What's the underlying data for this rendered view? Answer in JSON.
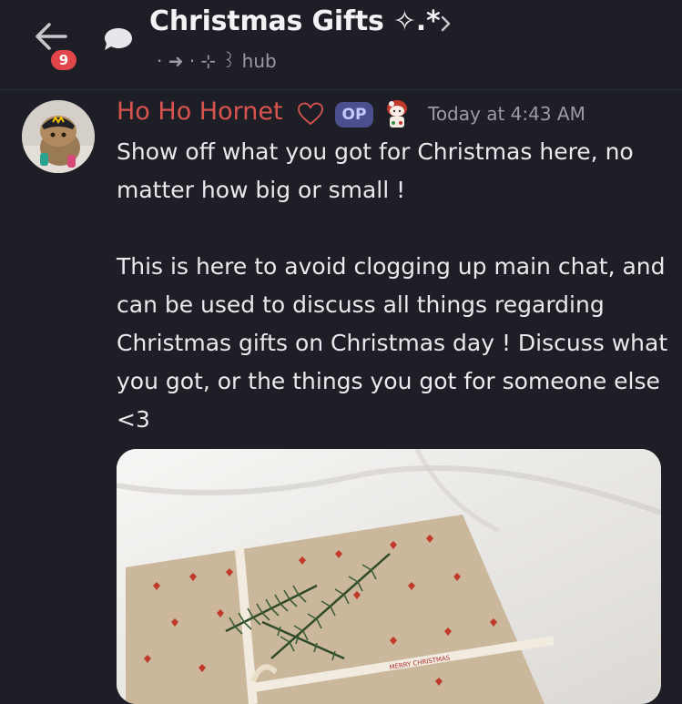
{
  "header": {
    "badge_count": "9",
    "title": "Christmas Gifts ✧.*",
    "subtitle": "· ➜ · ⊹ ꒱ hub"
  },
  "message": {
    "author": "Ho Ho Hornet",
    "op_label": "OP",
    "timestamp": "Today at 4:43 AM",
    "body": "Show off what you got for Christmas here, no matter how big or small !\n\nThis is here to avoid clogging up main chat, and can be used to discuss all things regarding Christmas gifts on Christmas day ! Discuss what you got, or the things you got for someone else <3"
  },
  "attachment": {
    "ribbon_text": "MERRY CHRISTMAS"
  },
  "colors": {
    "background": "#1e1f26",
    "author": "#d9534f",
    "badge": "#e0464a",
    "op_badge": "#4b4f8e"
  },
  "icons": [
    "back-arrow-icon",
    "thread-bubble-icon",
    "chevron-right-icon",
    "heart-outline-icon",
    "role-emoji-icon"
  ]
}
